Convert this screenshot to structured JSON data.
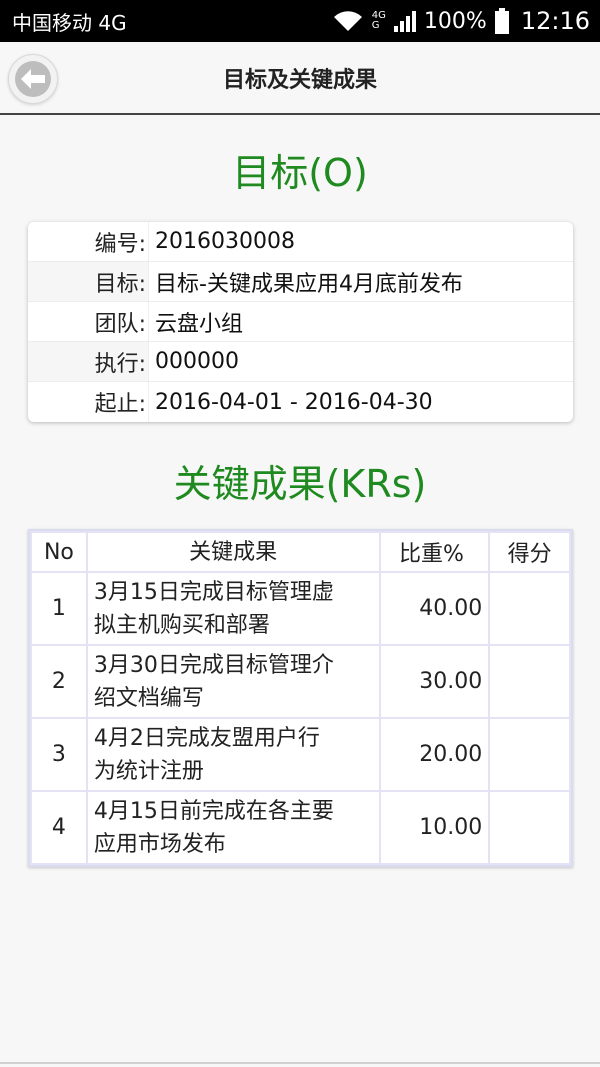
{
  "status_bar": {
    "carrier": "中国移动 4G",
    "network_small_top": "4G",
    "network_small_bottom": "G",
    "battery": "100%",
    "time": "12:16"
  },
  "header": {
    "title": "目标及关键成果",
    "back_icon": "back-arrow-icon"
  },
  "objective": {
    "section_title": "目标(O)",
    "rows": [
      {
        "label": "编号:",
        "value": "2016030008"
      },
      {
        "label": "目标:",
        "value": "目标-关键成果应用4月底前发布"
      },
      {
        "label": "团队:",
        "value": "云盘小组"
      },
      {
        "label": "执行:",
        "value": "000000"
      },
      {
        "label": "起止:",
        "value": "2016-04-01 - 2016-04-30"
      }
    ]
  },
  "key_results": {
    "section_title": "关键成果(KRs)",
    "headers": {
      "no": "No",
      "kr": "关键成果",
      "weight": "比重%",
      "score": "得分"
    },
    "rows": [
      {
        "no": "1",
        "kr_line1": "3月15日完成目标管理虚",
        "kr_line2": "拟主机购买和部署",
        "weight": "40.00",
        "score": ""
      },
      {
        "no": "2",
        "kr_line1": "3月30日完成目标管理介",
        "kr_line2": "绍文档编写",
        "weight": "30.00",
        "score": ""
      },
      {
        "no": "3",
        "kr_line1": "4月2日完成友盟用户行",
        "kr_line2": "为统计注册",
        "weight": "20.00",
        "score": ""
      },
      {
        "no": "4",
        "kr_line1": "4月15日前完成在各主要",
        "kr_line2": "应用市场发布",
        "weight": "10.00",
        "score": ""
      }
    ]
  },
  "colors": {
    "accent_green": "#1f8a1f",
    "status_bar_bg": "#000000",
    "table_border": "#e3e3f5"
  }
}
